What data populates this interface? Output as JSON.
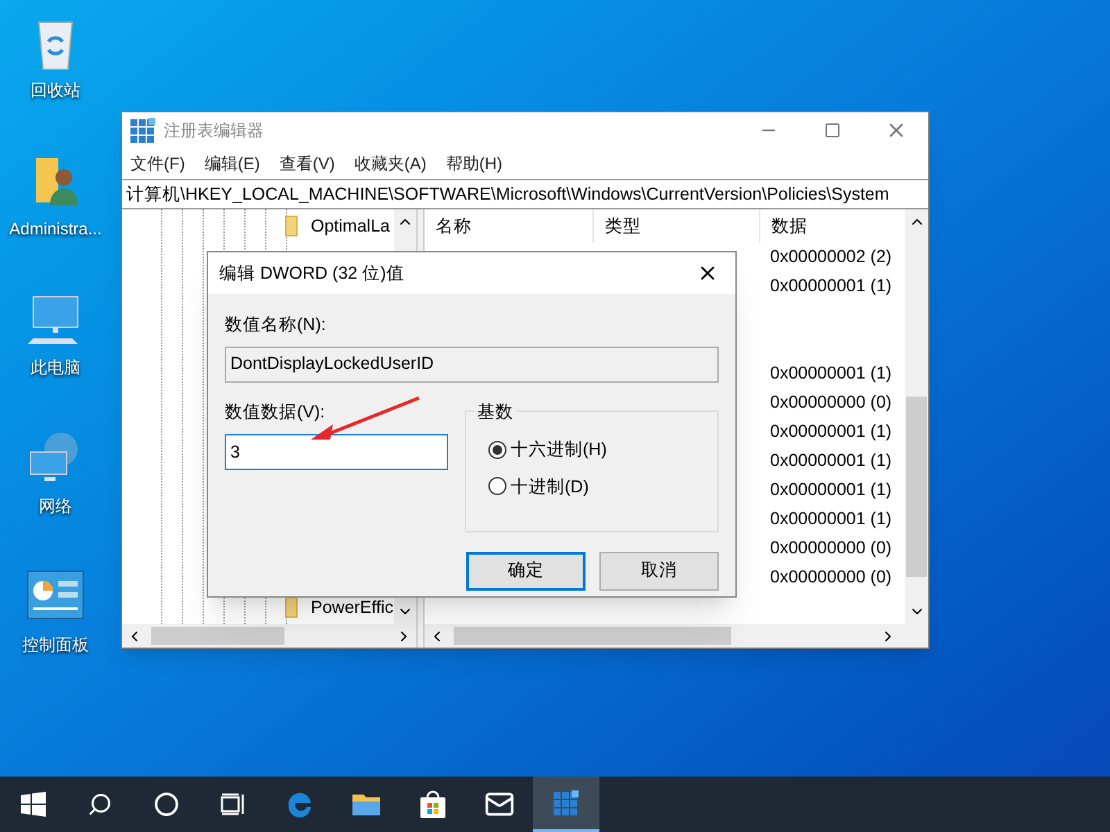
{
  "desktop_icons": [
    {
      "kind": "recycle",
      "label": "回收站"
    },
    {
      "kind": "user",
      "label": "Administra..."
    },
    {
      "kind": "computer",
      "label": "此电脑"
    },
    {
      "kind": "network",
      "label": "网络"
    },
    {
      "kind": "control",
      "label": "控制面板"
    }
  ],
  "window": {
    "title": "注册表编辑器",
    "menu": [
      "文件(F)",
      "编辑(E)",
      "查看(V)",
      "收藏夹(A)",
      "帮助(H)"
    ],
    "address": "计算机\\HKEY_LOCAL_MACHINE\\SOFTWARE\\Microsoft\\Windows\\CurrentVersion\\Policies\\System",
    "tree": [
      {
        "label": "OptimalLa"
      },
      {
        "label": "PowerEffic"
      }
    ],
    "columns": [
      "名称",
      "类型",
      "数据"
    ],
    "rows": [
      {
        "kind": "value",
        "data": "0x00000002 (2)"
      },
      {
        "kind": "value",
        "data": "0x00000001 (1)"
      },
      {
        "kind": "blank"
      },
      {
        "kind": "blank"
      },
      {
        "kind": "value",
        "data": "0x00000001 (1)"
      },
      {
        "kind": "value",
        "data": "0x00000000 (0)"
      },
      {
        "kind": "value",
        "data": "0x00000001 (1)"
      },
      {
        "kind": "value",
        "data": "0x00000001 (1)"
      },
      {
        "kind": "value",
        "data": "0x00000001 (1)"
      },
      {
        "kind": "value",
        "data": "0x00000001 (1)"
      },
      {
        "kind": "value",
        "data": "0x00000000 (0)"
      },
      {
        "kind": "value",
        "data": "0x00000000 (0)"
      }
    ]
  },
  "dialog": {
    "title": "编辑 DWORD (32 位)值",
    "name_label": "数值名称(N):",
    "name_value": "DontDisplayLockedUserID",
    "data_label": "数值数据(V):",
    "data_value": "3",
    "base_label": "基数",
    "bases": [
      {
        "label": "十六进制(H)",
        "selected": true
      },
      {
        "label": "十进制(D)",
        "selected": false
      }
    ],
    "buttons": [
      {
        "label": "确定",
        "default": true
      },
      {
        "label": "取消",
        "default": false
      }
    ]
  },
  "taskbar": [
    {
      "kind": "start",
      "active": false
    },
    {
      "kind": "search",
      "active": false
    },
    {
      "kind": "cortana",
      "active": false
    },
    {
      "kind": "taskview",
      "active": false
    },
    {
      "kind": "edge",
      "active": false
    },
    {
      "kind": "explorer",
      "active": false
    },
    {
      "kind": "store",
      "active": false
    },
    {
      "kind": "mail",
      "active": false
    },
    {
      "kind": "regedit",
      "active": true
    }
  ]
}
